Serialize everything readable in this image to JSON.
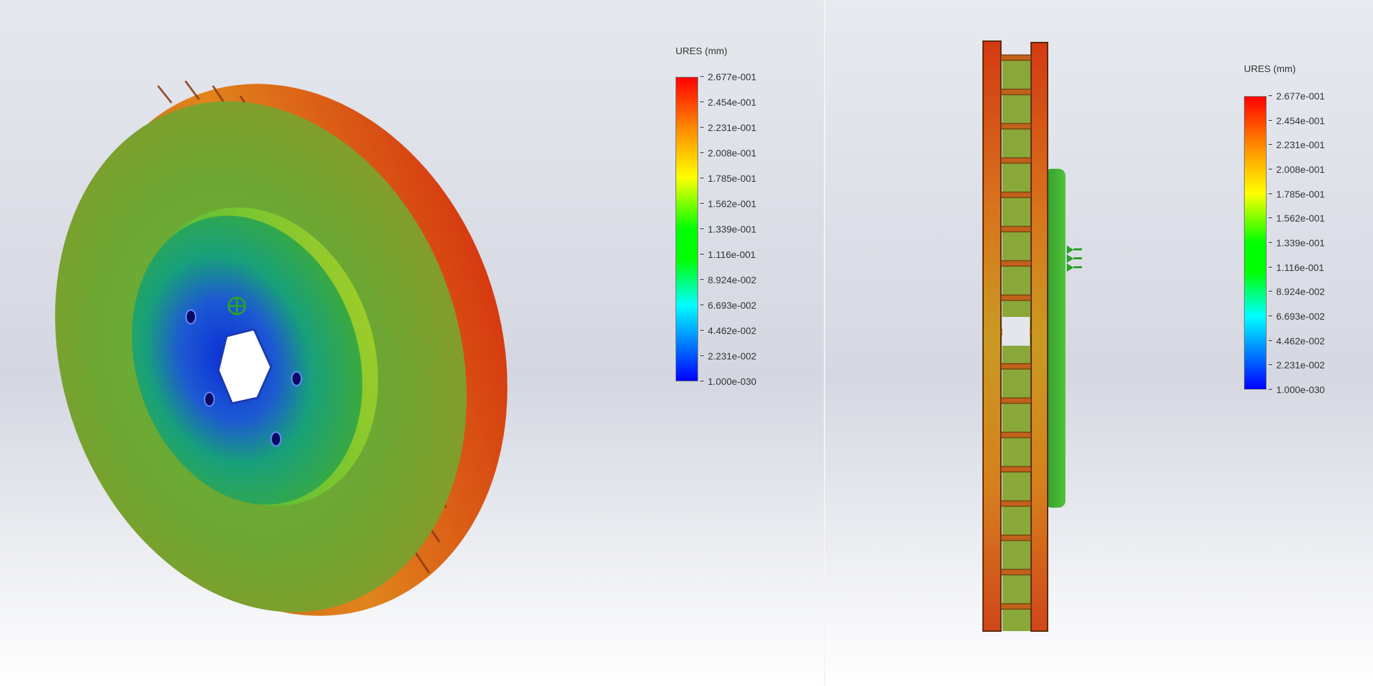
{
  "views": [
    {
      "id": "isometric",
      "legend": {
        "title": "URES (mm)",
        "labels": [
          "2.677e-001",
          "2.454e-001",
          "2.231e-001",
          "2.008e-001",
          "1.785e-001",
          "1.562e-001",
          "1.339e-001",
          "1.116e-001",
          "8.924e-002",
          "6.693e-002",
          "4.462e-002",
          "2.231e-002",
          "1.000e-030"
        ]
      }
    },
    {
      "id": "side",
      "legend": {
        "title": "URES (mm)",
        "labels": [
          "2.677e-001",
          "2.454e-001",
          "2.231e-001",
          "2.008e-001",
          "1.785e-001",
          "1.562e-001",
          "1.339e-001",
          "1.116e-001",
          "8.924e-002",
          "6.693e-002",
          "4.462e-002",
          "2.231e-002",
          "1.000e-030"
        ]
      }
    }
  ],
  "colors": {
    "scale_max": "#ff0000",
    "scale_orange": "#ff8c00",
    "scale_yellow": "#ffff00",
    "scale_green": "#00ff00",
    "scale_cyan": "#00ffff",
    "scale_min": "#0000ff",
    "background_top": "#d5d8e2",
    "background_bottom": "#ffffff"
  },
  "icons": [
    "fixture-arrows-icon",
    "fixture-arrows-icon"
  ]
}
